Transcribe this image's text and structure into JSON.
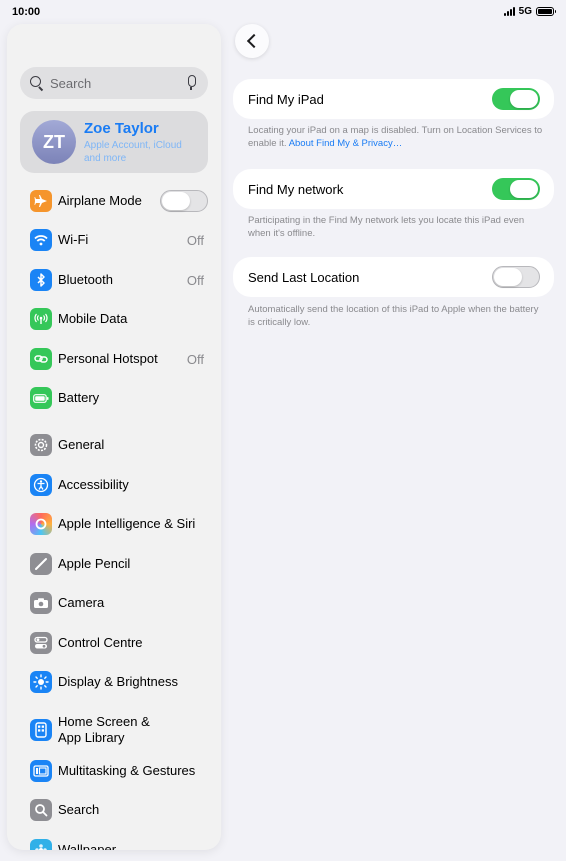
{
  "status": {
    "time": "10:00",
    "network": "5G"
  },
  "sidebar": {
    "search_placeholder": "Search",
    "profile": {
      "initials": "ZT",
      "name": "Zoe Taylor",
      "subtitle": "Apple Account, iCloud and more"
    },
    "items": [
      {
        "label": "Airplane Mode",
        "icon": "airplane-icon",
        "color": "#f5952c",
        "toggle": "off"
      },
      {
        "label": "Wi-Fi",
        "icon": "wifi-icon",
        "color": "#1a84f5",
        "value": "Off"
      },
      {
        "label": "Bluetooth",
        "icon": "bluetooth-icon",
        "color": "#1a84f5",
        "value": "Off"
      },
      {
        "label": "Mobile Data",
        "icon": "antenna-icon",
        "color": "#35c759"
      },
      {
        "label": "Personal Hotspot",
        "icon": "link-icon",
        "color": "#35c759",
        "value": "Off"
      },
      {
        "label": "Battery",
        "icon": "battery-icon",
        "color": "#35c759"
      },
      {
        "label": "General",
        "icon": "gear-icon",
        "color": "#8e8e93"
      },
      {
        "label": "Accessibility",
        "icon": "accessibility-icon",
        "color": "#1a84f5"
      },
      {
        "label": "Apple Intelligence & Siri",
        "icon": "siri-icon",
        "color": "#ff6a5b"
      },
      {
        "label": "Apple Pencil",
        "icon": "pencil-icon",
        "color": "#8e8e93"
      },
      {
        "label": "Camera",
        "icon": "camera-icon",
        "color": "#8e8e93"
      },
      {
        "label": "Control Centre",
        "icon": "switches-icon",
        "color": "#8e8e93"
      },
      {
        "label": "Display & Brightness",
        "icon": "sun-icon",
        "color": "#1a84f5"
      },
      {
        "label": "Home Screen & App Library",
        "icon": "home-screen-icon",
        "color": "#1a84f5"
      },
      {
        "label": "Multitasking & Gestures",
        "icon": "multitasking-icon",
        "color": "#1a84f5"
      },
      {
        "label": "Search",
        "icon": "search-icon",
        "color": "#8e8e93"
      },
      {
        "label": "Wallpaper",
        "icon": "wallpaper-icon",
        "color": "#30b0e8"
      }
    ]
  },
  "main": {
    "settings": [
      {
        "label": "Find My iPad",
        "toggle": "on",
        "footnote": "Locating your iPad on a map is disabled. Turn on Location Services to enable it.",
        "link": "About Find My & Privacy…"
      },
      {
        "label": "Find My network",
        "toggle": "on",
        "footnote": "Participating in the Find My network lets you locate this iPad even when it's offline."
      },
      {
        "label": "Send Last Location",
        "toggle": "off",
        "footnote": "Automatically send the location of this iPad to Apple when the battery is critically low."
      }
    ]
  }
}
